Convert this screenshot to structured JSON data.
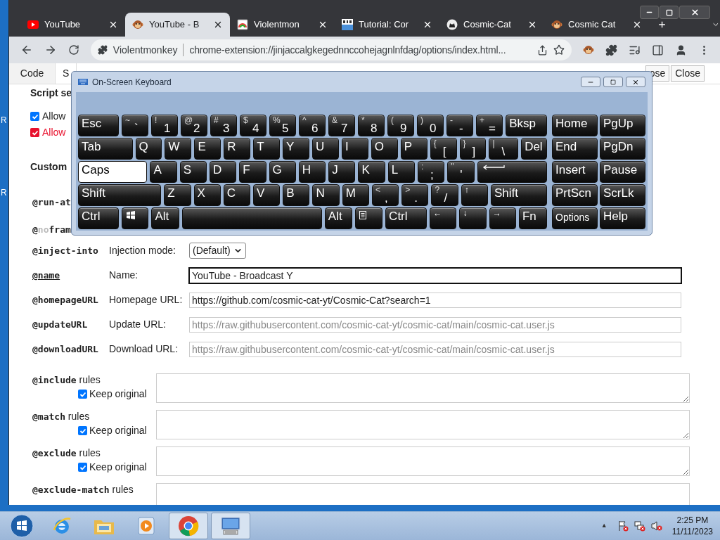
{
  "desktop": {
    "icon_labels": [
      "R",
      "R"
    ]
  },
  "browser": {
    "tabs": [
      {
        "title": "YouTube",
        "kind": "youtube",
        "selected": false
      },
      {
        "title": "YouTube - B",
        "kind": "monkey",
        "selected": true
      },
      {
        "title": "Violentmon",
        "kind": "rainbow",
        "selected": false
      },
      {
        "title": "Tutorial: Cor",
        "kind": "bit",
        "selected": false
      },
      {
        "title": "Cosmic-Cat",
        "kind": "github",
        "selected": false
      },
      {
        "title": "Cosmic Cat",
        "kind": "monkey",
        "selected": false
      }
    ],
    "omnibox": {
      "site": "Violentmonkey",
      "url": "chrome-extension://jinjaccalgkegednnccohejagnlnfdag/options/index.html..."
    }
  },
  "page": {
    "tabs": [
      {
        "label": "Code",
        "selected": false
      },
      {
        "label": "S",
        "selected": true
      }
    ],
    "buttons": [
      "ose",
      "Close"
    ],
    "script_settings": {
      "heading": "Script se",
      "options": [
        {
          "label": "Allow",
          "checked": true,
          "kind": "normal"
        },
        {
          "label": "Allow",
          "checked": true,
          "kind": "warning"
        }
      ]
    },
    "custom": {
      "heading": "Custom",
      "directives": [
        {
          "parts": [
            {
              "text": "@run-at",
              "muted": false
            }
          ]
        },
        {
          "parts": [
            {
              "text": "@",
              "muted": false
            },
            {
              "text": "no",
              "muted": true
            },
            {
              "text": "fram",
              "muted": false
            }
          ]
        }
      ]
    },
    "fields": [
      {
        "directive": "@inject-into",
        "underlined": false,
        "label": "Injection mode:",
        "kind": "select",
        "value": "(Default)",
        "focused": false
      },
      {
        "directive": "@name",
        "underlined": true,
        "label": "Name:",
        "kind": "text",
        "value": "YouTube - Broadcast Y",
        "focused": true
      },
      {
        "directive": "@homepageURL",
        "underlined": false,
        "label": "Homepage URL:",
        "kind": "text",
        "value": "https://github.com/cosmic-cat-yt/Cosmic-Cat?search=1",
        "focused": false
      },
      {
        "directive": "@updateURL",
        "underlined": false,
        "label": "Update URL:",
        "kind": "text",
        "placeholder": "https://raw.githubusercontent.com/cosmic-cat-yt/cosmic-cat/main/cosmic-cat.user.js",
        "focused": false
      },
      {
        "directive": "@downloadURL",
        "underlined": false,
        "label": "Download URL:",
        "kind": "text",
        "placeholder": "https://raw.githubusercontent.com/cosmic-cat-yt/cosmic-cat/main/cosmic-cat.user.js",
        "focused": false
      }
    ],
    "rules": [
      {
        "directive": "@include",
        "suffix": "rules",
        "keep": {
          "label": "Keep original",
          "checked": true
        }
      },
      {
        "directive": "@match",
        "suffix": "rules",
        "keep": {
          "label": "Keep original",
          "checked": true
        }
      },
      {
        "directive": "@exclude",
        "suffix": "rules",
        "keep": {
          "label": "Keep original",
          "checked": true
        }
      },
      {
        "directive": "@exclude-match",
        "suffix": "rules"
      }
    ]
  },
  "osk": {
    "title": "On-Screen Keyboard",
    "main_rows": [
      [
        {
          "label": "Esc",
          "kind": "text",
          "on": false
        },
        {
          "shift": "~",
          "label": "`",
          "kind": "dual",
          "on": false
        },
        {
          "shift": "!",
          "label": "1",
          "kind": "dual",
          "on": false
        },
        {
          "shift": "@",
          "label": "2",
          "kind": "dual",
          "on": false
        },
        {
          "shift": "#",
          "label": "3",
          "kind": "dual",
          "on": false
        },
        {
          "shift": "$",
          "label": "4",
          "kind": "dual",
          "on": false
        },
        {
          "shift": "%",
          "label": "5",
          "kind": "dual",
          "on": false
        },
        {
          "shift": "^",
          "label": "6",
          "kind": "dual",
          "on": false
        },
        {
          "shift": "&",
          "label": "7",
          "kind": "dual",
          "on": false
        },
        {
          "shift": "*",
          "label": "8",
          "kind": "dual",
          "on": false
        },
        {
          "shift": "(",
          "label": "9",
          "kind": "dual",
          "on": false
        },
        {
          "shift": ")",
          "label": "0",
          "kind": "dual",
          "on": false
        },
        {
          "shift": "-",
          "label": "-",
          "kind": "dual",
          "on": false
        },
        {
          "shift": "+",
          "label": "=",
          "kind": "dual",
          "on": false
        },
        {
          "label": "Bksp",
          "kind": "text",
          "on": false
        }
      ],
      [
        {
          "label": "Tab",
          "kind": "text",
          "on": false
        },
        {
          "label": "Q",
          "kind": "text",
          "on": false
        },
        {
          "label": "W",
          "kind": "text",
          "on": false
        },
        {
          "label": "E",
          "kind": "text",
          "on": false
        },
        {
          "label": "R",
          "kind": "text",
          "on": false
        },
        {
          "label": "T",
          "kind": "text",
          "on": false
        },
        {
          "label": "Y",
          "kind": "text",
          "on": false
        },
        {
          "label": "U",
          "kind": "text",
          "on": false
        },
        {
          "label": "I",
          "kind": "text",
          "on": false
        },
        {
          "label": "O",
          "kind": "text",
          "on": false
        },
        {
          "label": "P",
          "kind": "text",
          "on": false
        },
        {
          "shift": "{",
          "label": "[",
          "kind": "dual",
          "on": false
        },
        {
          "shift": "}",
          "label": "]",
          "kind": "dual",
          "on": false
        },
        {
          "shift": "|",
          "label": "\\",
          "kind": "dual",
          "on": false
        },
        {
          "label": "Del",
          "kind": "text",
          "on": false
        }
      ],
      [
        {
          "label": "Caps",
          "kind": "text",
          "on": true
        },
        {
          "label": "A",
          "kind": "text",
          "on": false
        },
        {
          "label": "S",
          "kind": "text",
          "on": false
        },
        {
          "label": "D",
          "kind": "text",
          "on": false
        },
        {
          "label": "F",
          "kind": "text",
          "on": false
        },
        {
          "label": "G",
          "kind": "text",
          "on": false
        },
        {
          "label": "H",
          "kind": "text",
          "on": false
        },
        {
          "label": "J",
          "kind": "text",
          "on": false
        },
        {
          "label": "K",
          "kind": "text",
          "on": false
        },
        {
          "label": "L",
          "kind": "text",
          "on": false
        },
        {
          "shift": ":",
          "label": ";",
          "kind": "dual",
          "on": false
        },
        {
          "shift": "\"",
          "label": "'",
          "kind": "dual",
          "on": false
        },
        {
          "kind": "enter",
          "on": false
        }
      ],
      [
        {
          "label": "Shift",
          "kind": "text",
          "on": false
        },
        {
          "label": "Z",
          "kind": "text",
          "on": false
        },
        {
          "label": "X",
          "kind": "text",
          "on": false
        },
        {
          "label": "C",
          "kind": "text",
          "on": false
        },
        {
          "label": "V",
          "kind": "text",
          "on": false
        },
        {
          "label": "B",
          "kind": "text",
          "on": false
        },
        {
          "label": "N",
          "kind": "text",
          "on": false
        },
        {
          "label": "M",
          "kind": "text",
          "on": false
        },
        {
          "shift": "<",
          "label": ",",
          "kind": "dual",
          "on": false
        },
        {
          "shift": ">",
          "label": ".",
          "kind": "dual",
          "on": false
        },
        {
          "shift": "?",
          "label": "/",
          "kind": "dual",
          "on": false
        },
        {
          "label": "↑",
          "kind": "small",
          "on": false
        },
        {
          "label": "Shift",
          "kind": "text",
          "on": false
        }
      ],
      [
        {
          "label": "Ctrl",
          "kind": "text",
          "on": false
        },
        {
          "kind": "windows",
          "on": false
        },
        {
          "label": "Alt",
          "kind": "text",
          "on": false
        },
        {
          "kind": "space",
          "on": false
        },
        {
          "label": "Alt",
          "kind": "text",
          "on": false
        },
        {
          "kind": "menu",
          "on": false
        },
        {
          "label": "Ctrl",
          "kind": "text",
          "on": false
        },
        {
          "label": "←",
          "kind": "small",
          "on": false
        },
        {
          "label": "↓",
          "kind": "small",
          "on": false
        },
        {
          "label": "→",
          "kind": "small",
          "on": false
        },
        {
          "label": "Fn",
          "kind": "text",
          "on": false
        }
      ]
    ],
    "nav_rows": [
      [
        {
          "label": "Home",
          "kind": "text",
          "on": false
        },
        {
          "label": "PgUp",
          "kind": "text",
          "on": false
        }
      ],
      [
        {
          "label": "End",
          "kind": "text",
          "on": false
        },
        {
          "label": "PgDn",
          "kind": "text",
          "on": false
        }
      ],
      [
        {
          "label": "Insert",
          "kind": "text",
          "on": false
        },
        {
          "label": "Pause",
          "kind": "text",
          "on": false
        }
      ],
      [
        {
          "label": "PrtScn",
          "kind": "text",
          "on": false
        },
        {
          "label": "ScrLk",
          "kind": "text",
          "on": false
        }
      ],
      [
        {
          "label": "Options",
          "kind": "options",
          "on": false
        },
        {
          "label": "Help",
          "kind": "text",
          "on": false
        }
      ]
    ]
  },
  "taskbar": {
    "items": [
      {
        "kind": "ie",
        "running": false
      },
      {
        "kind": "explorer",
        "running": false
      },
      {
        "kind": "media",
        "running": false
      },
      {
        "kind": "chrome",
        "running": true
      },
      {
        "kind": "keyboard",
        "running": true
      }
    ],
    "tray_arrow": "▲",
    "time": "2:25 PM",
    "date": "11/11/2023"
  }
}
